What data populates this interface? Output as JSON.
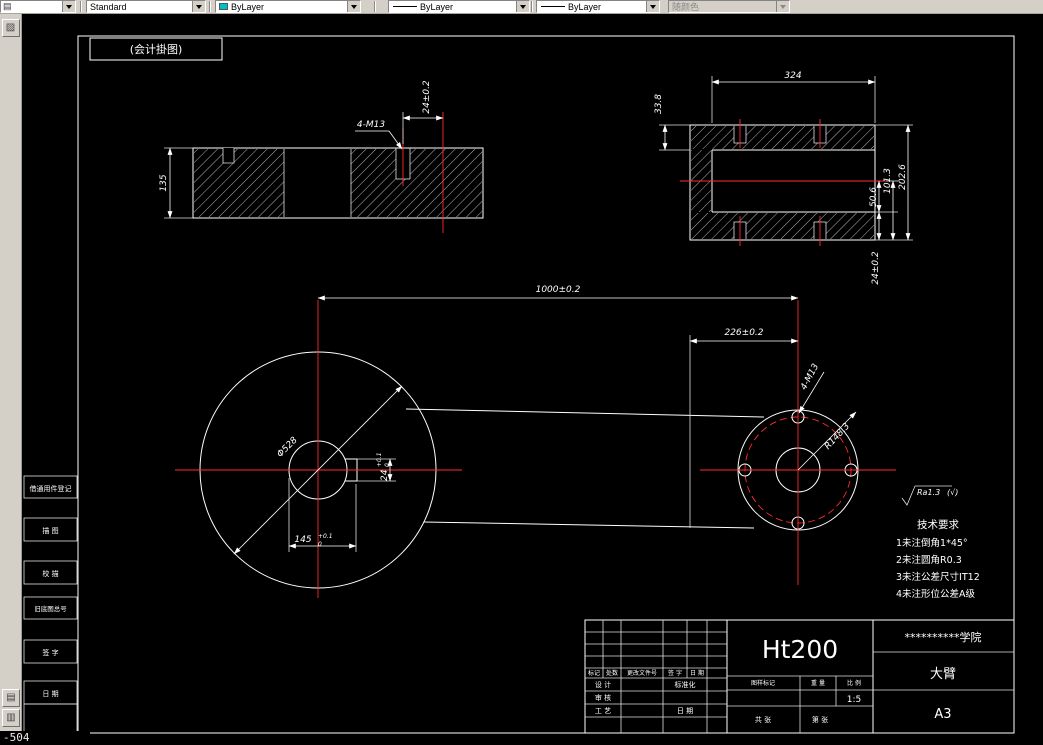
{
  "colors": {
    "accent_cyan": "#00c0c0",
    "centerline_red": "#ff2b2b",
    "line_white": "#ffffff"
  },
  "window": {
    "status_fragment": "-504"
  },
  "icons": {
    "layers": "▤",
    "left_top": "▨",
    "left_bottom1": "▤",
    "left_bottom2": "▥"
  },
  "toolbar": {
    "style": "Standard",
    "color": "ByLayer",
    "linetype": "ByLayer",
    "lineweight": "ByLayer",
    "plot_style": "随颜色"
  },
  "sheet": {
    "view_label": "(会计掛图)",
    "margin_blocks": [
      "借通用件登记",
      "描 图",
      "校 描",
      "旧底图总号",
      "签 字",
      "日 期"
    ]
  },
  "dims": {
    "m13_top": "4-M13",
    "d24_top": "24±0.2",
    "d324": "324",
    "d33_8": "33.8",
    "d135": "135",
    "d50_6": "50.6",
    "d101_3": "101.3",
    "d202_6": "202.6",
    "d24_flange": "24±0.2",
    "d1000": "1000±0.2",
    "d226": "226±0.2",
    "dia528": "Φ528",
    "d145": "145",
    "d145_up": "+0.1",
    "d145_dn": "0",
    "d24_slot": "24",
    "d24_up": "+0.1",
    "d24_dn": "0",
    "m13_plan": "4-M13",
    "r148": "R148.3"
  },
  "finish": {
    "value": "Ra1.3",
    "check": "(√)"
  },
  "tech": {
    "title": "技术要求",
    "lines": [
      "1未注倒角1*45°",
      "2未注圆角R0.3",
      "3未注公差尺寸IT12",
      "4未注形位公差A级"
    ]
  },
  "titleblock": {
    "material": "Ht200",
    "org": "**********学院",
    "part": "大臂",
    "paper": "A3",
    "scale": "1:5",
    "rev_header": [
      "标记",
      "处数",
      "更改文件号",
      "签 字",
      "日 期"
    ],
    "sig_col1": [
      "设 计",
      "审 核",
      "工 艺"
    ],
    "sig_col2": [
      "标准化",
      "日 期"
    ],
    "info_header": [
      "图样标记",
      "重 量",
      "比 例"
    ],
    "sheets": [
      "共 张",
      "第 张"
    ]
  }
}
